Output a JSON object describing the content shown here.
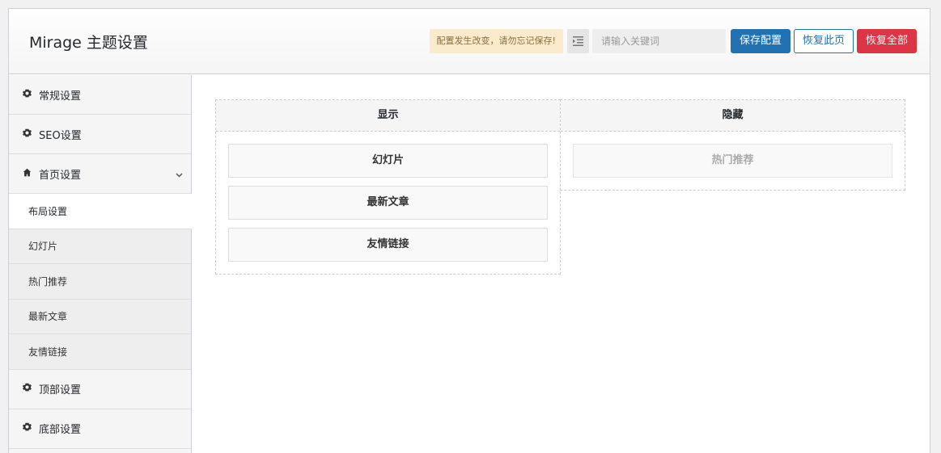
{
  "header": {
    "title": "Mirage 主题设置",
    "notice": "配置发生改变，请勿忘记保存!",
    "search_placeholder": "请输入关键词",
    "save_label": "保存配置",
    "reset_page_label": "恢复此页",
    "reset_all_label": "恢复全部"
  },
  "sidebar": {
    "items": [
      {
        "label": "常规设置",
        "icon": "gear-icon"
      },
      {
        "label": "SEO设置",
        "icon": "gear-icon"
      },
      {
        "label": "首页设置",
        "icon": "home-icon",
        "expanded": true
      }
    ],
    "sub_items": [
      {
        "label": "布局设置",
        "active": true
      },
      {
        "label": "幻灯片"
      },
      {
        "label": "热门推荐"
      },
      {
        "label": "最新文章"
      },
      {
        "label": "友情链接"
      }
    ],
    "items_after": [
      {
        "label": "顶部设置",
        "icon": "gear-icon"
      },
      {
        "label": "底部设置",
        "icon": "gear-icon"
      }
    ]
  },
  "layout": {
    "shown_title": "显示",
    "hidden_title": "隐藏",
    "shown": [
      "幻灯片",
      "最新文章",
      "友情链接"
    ],
    "hidden": [
      "热门推荐"
    ]
  }
}
